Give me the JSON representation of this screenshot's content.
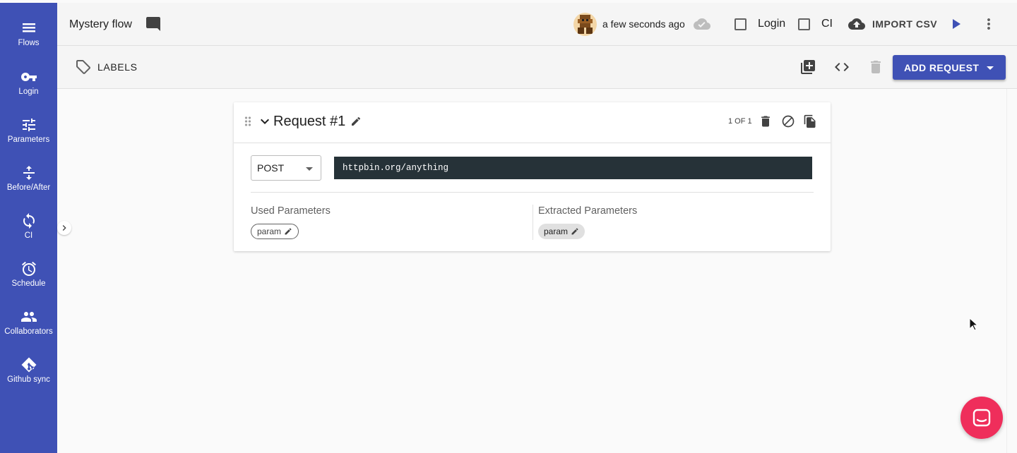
{
  "sidebar": {
    "items": [
      {
        "label": "Flows",
        "icon": "menu-icon"
      },
      {
        "label": "Login",
        "icon": "key-icon"
      },
      {
        "label": "Parameters",
        "icon": "tune-icon"
      },
      {
        "label": "Before/After",
        "icon": "vertical-split-icon"
      },
      {
        "label": "CI",
        "icon": "sync-icon"
      },
      {
        "label": "Schedule",
        "icon": "alarm-icon"
      },
      {
        "label": "Collaborators",
        "icon": "people-icon"
      },
      {
        "label": "Github sync",
        "icon": "git-icon"
      }
    ]
  },
  "header": {
    "title": "Mystery flow",
    "saved_text": "a few seconds ago",
    "login_label": "Login",
    "login_checked": false,
    "ci_label": "CI",
    "ci_checked": false,
    "import_label": "IMPORT CSV"
  },
  "toolbar": {
    "labels_label": "LABELS",
    "add_request_label": "ADD REQUEST"
  },
  "request": {
    "title": "Request #1",
    "counter": "1 OF 1",
    "method": "POST",
    "url": "httpbin.org/anything",
    "used_params_label": "Used Parameters",
    "used_params": [
      "param"
    ],
    "extracted_params_label": "Extracted Parameters",
    "extracted_params": [
      "param"
    ]
  },
  "colors": {
    "primary": "#3f51b5",
    "url_bg": "#263238",
    "chat": "#ef2e5b"
  }
}
